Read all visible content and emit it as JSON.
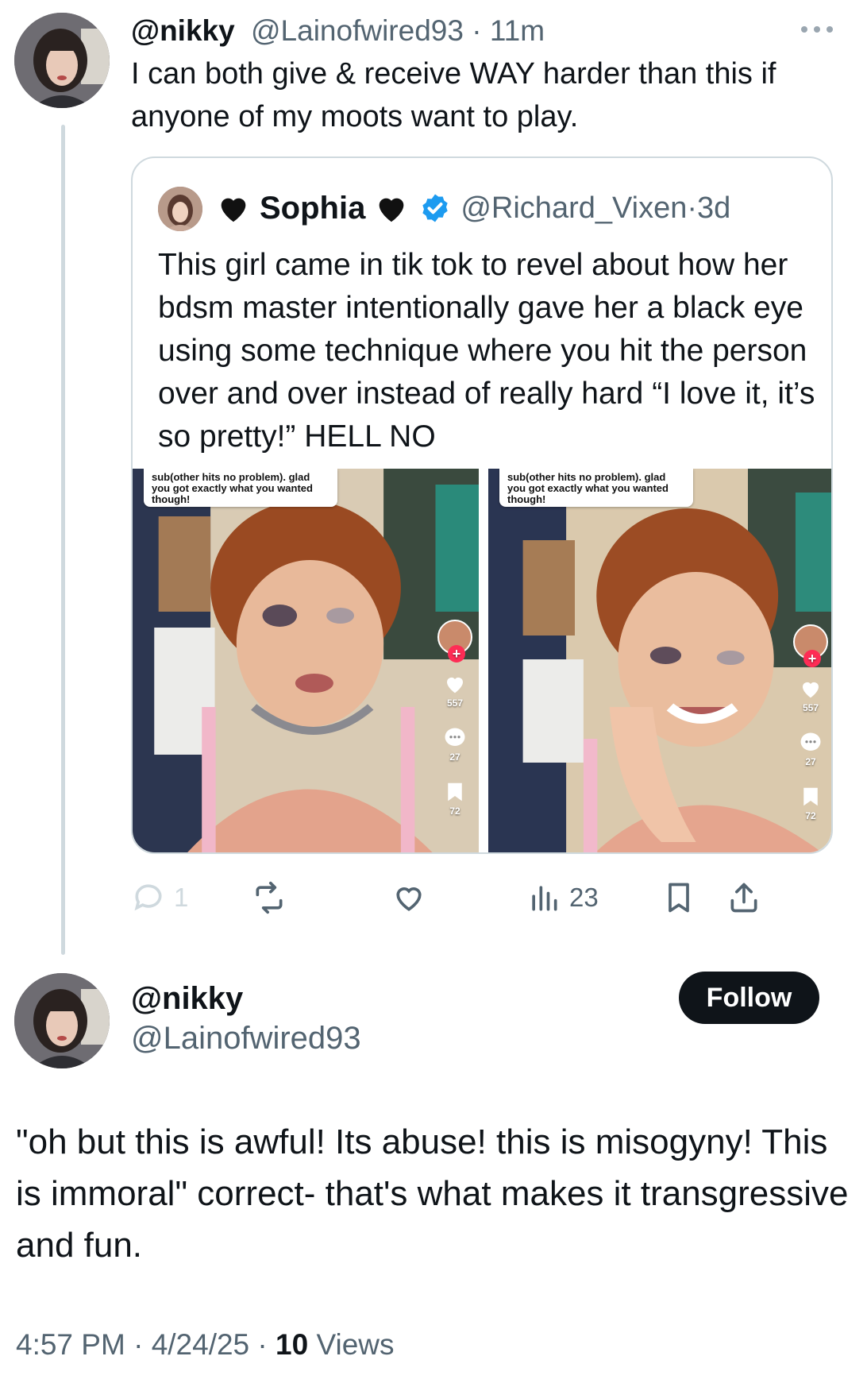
{
  "tweet1": {
    "display_name": "@nikky",
    "handle": "@Lainofwired93",
    "separator": " · ",
    "time": "11m",
    "text": "I can both give & receive WAY harder than this if anyone of my moots want to play."
  },
  "quoted": {
    "display_name": "Sophia",
    "handle": "@Richard_Vixen",
    "separator": " · ",
    "time": "3d",
    "text": "This girl came in tik tok to revel about how her bdsm master intentionally gave her a black eye using some technique where you hit the person over and over instead of really hard “I love it, it’s so pretty!” HELL NO",
    "media": [
      {
        "caption": "sub(other hits no problem). glad you got exactly what you wanted though!",
        "likes": "557",
        "comments": "27",
        "saves": "72"
      },
      {
        "caption": "sub(other hits no problem). glad you got exactly what you wanted though!",
        "likes": "557",
        "comments": "27",
        "saves": "72"
      }
    ]
  },
  "actions": {
    "replies": "1",
    "views": "23"
  },
  "tweet2": {
    "display_name": "@nikky",
    "handle": "@Lainofwired93",
    "follow_label": "Follow",
    "text": "\"oh but this is awful! Its abuse! this is misogyny! This is immoral\" correct- that's what makes it transgressive and fun.",
    "time": "4:57 PM",
    "date": "4/24/25",
    "views_count": "10",
    "views_label": " Views",
    "separator": " · "
  },
  "colors": {
    "text_primary": "#0f1419",
    "text_secondary": "#536471",
    "verified": "#1d9bf0",
    "border": "#cfd9de"
  },
  "icons": [
    "more-icon",
    "black-heart-icon",
    "verified-icon",
    "reply-icon",
    "retweet-icon",
    "like-icon",
    "views-icon",
    "bookmark-icon",
    "share-icon"
  ]
}
